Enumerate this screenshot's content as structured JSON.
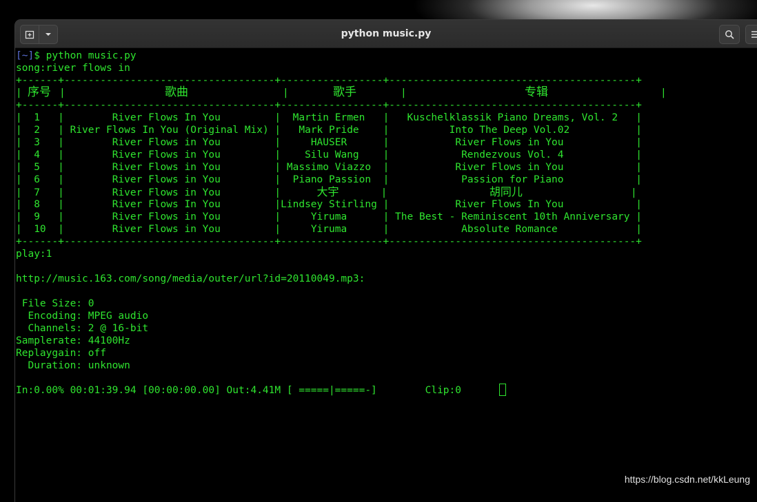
{
  "window": {
    "title": "python music.py"
  },
  "terminal": {
    "prompt_dir": "[~]",
    "prompt_symbol": "$",
    "command": " python music.py",
    "song_query": "song:river flows in",
    "table": {
      "border": "+------+-----------------------------------+-----------------+-----------------------------------------+",
      "headers": [
        "序号",
        "歌曲",
        "歌手",
        "专辑"
      ],
      "rows": [
        [
          "1",
          "River Flows In You",
          "Martin Ermen",
          "Kuschelklassik Piano Dreams, Vol. 2"
        ],
        [
          "2",
          "River Flows In You (Original Mix)",
          "Mark Pride",
          "Into The Deep Vol.02"
        ],
        [
          "3",
          "River Flows in You",
          "HAUSER",
          "River Flows in You"
        ],
        [
          "4",
          "River Flows in You",
          "Silu Wang",
          "Rendezvous Vol. 4"
        ],
        [
          "5",
          "River Flows in You",
          "Massimo Viazzo",
          "River Flows in You"
        ],
        [
          "6",
          "River Flows in You",
          "Piano Passion",
          "Passion for Piano"
        ],
        [
          "7",
          "River Flows in You",
          "大宇",
          "胡同儿"
        ],
        [
          "8",
          "River Flows In You",
          "Lindsey Stirling",
          "River Flows In You"
        ],
        [
          "9",
          "River Flows in You",
          "Yiruma",
          "The Best - Reminiscent 10th Anniversary"
        ],
        [
          "10",
          "River Flows in You",
          "Yiruma",
          "Absolute Romance"
        ]
      ]
    },
    "play_line": "play:1",
    "url_line": "http://music.163.com/song/media/outer/url?id=20110049.mp3:",
    "info_lines": [
      " File Size: 0",
      "  Encoding: MPEG audio",
      "  Channels: 2 @ 16-bit",
      "Samplerate: 44100Hz",
      "Replaygain: off",
      "  Duration: unknown"
    ],
    "status_line": "In:0.00% 00:01:39.94 [00:00:00.00] Out:4.41M [ =====|=====-]        Clip:0"
  },
  "watermark": "https://blog.csdn.net/kkLeung",
  "colors": {
    "terminal_text": "#2fe52f",
    "prompt_bracket": "#5a6fd6",
    "titlebar": "#2f2f2f"
  },
  "icons": {
    "new_tab": "new-tab-icon",
    "dropdown": "chevron-down-icon",
    "search": "search-icon",
    "menu": "hamburger-menu-icon"
  }
}
